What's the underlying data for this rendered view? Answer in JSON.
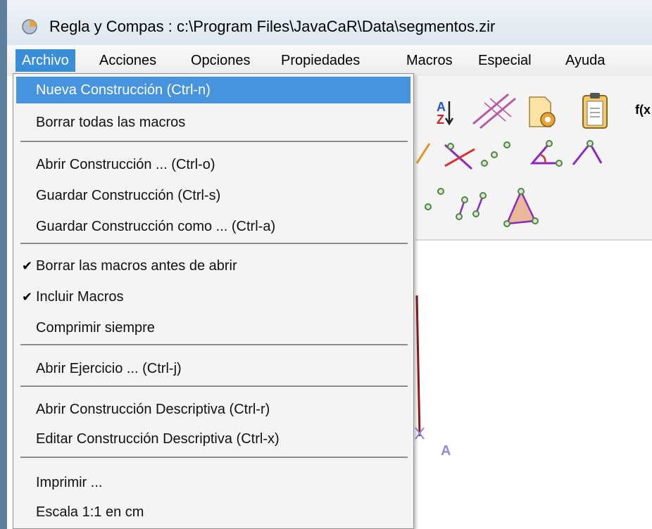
{
  "window": {
    "title": "Regla y Compas : c:\\Program Files\\JavaCaR\\Data\\segmentos.zir"
  },
  "menubar": {
    "items": [
      "Archivo",
      "Acciones",
      "Opciones",
      "Propiedades",
      "Macros",
      "Especial",
      "Ayuda"
    ],
    "active": "Archivo"
  },
  "archivo_menu": {
    "items": [
      {
        "label": "Nueva Construcción (Ctrl-n)",
        "highlighted": true
      },
      {
        "label": "Borrar todas las macros"
      },
      {
        "label": "Abrir Construcción ... (Ctrl-o)"
      },
      {
        "label": "Guardar Construcción (Ctrl-s)"
      },
      {
        "label": "Guardar Construcción como ... (Ctrl-a)"
      },
      {
        "label": "Borrar las macros antes de abrir",
        "checked": true
      },
      {
        "label": "Incluir Macros",
        "checked": true
      },
      {
        "label": "Comprimir siempre"
      },
      {
        "label": "Abrir Ejercicio ... (Ctrl-j)"
      },
      {
        "label": "Abrir Construcción Descriptiva (Ctrl-r)"
      },
      {
        "label": "Editar Construcción Descriptiva (Ctrl-x)"
      },
      {
        "label": "Imprimir ..."
      },
      {
        "label": "Escala 1:1 en cm"
      }
    ],
    "check_glyph": "✔"
  },
  "toolbar": {
    "visible_text": "f(x",
    "icons": [
      "sort-az-icon",
      "parallel-lines-icon",
      "macro-settings-icon",
      "clipboard-icon",
      "perpendicular-icon",
      "intersection-icon",
      "points-icon",
      "angle-icon",
      "angle-mark-icon",
      "polygon-points-icon",
      "segments-icon",
      "triangle-icon"
    ]
  },
  "canvas": {
    "point_label": "A"
  },
  "colors": {
    "menu_highlight": "#4793dd",
    "menubar_active": "#3a8ed8",
    "point_label": "#8e8ed8",
    "segment": "#8b1a1a"
  }
}
